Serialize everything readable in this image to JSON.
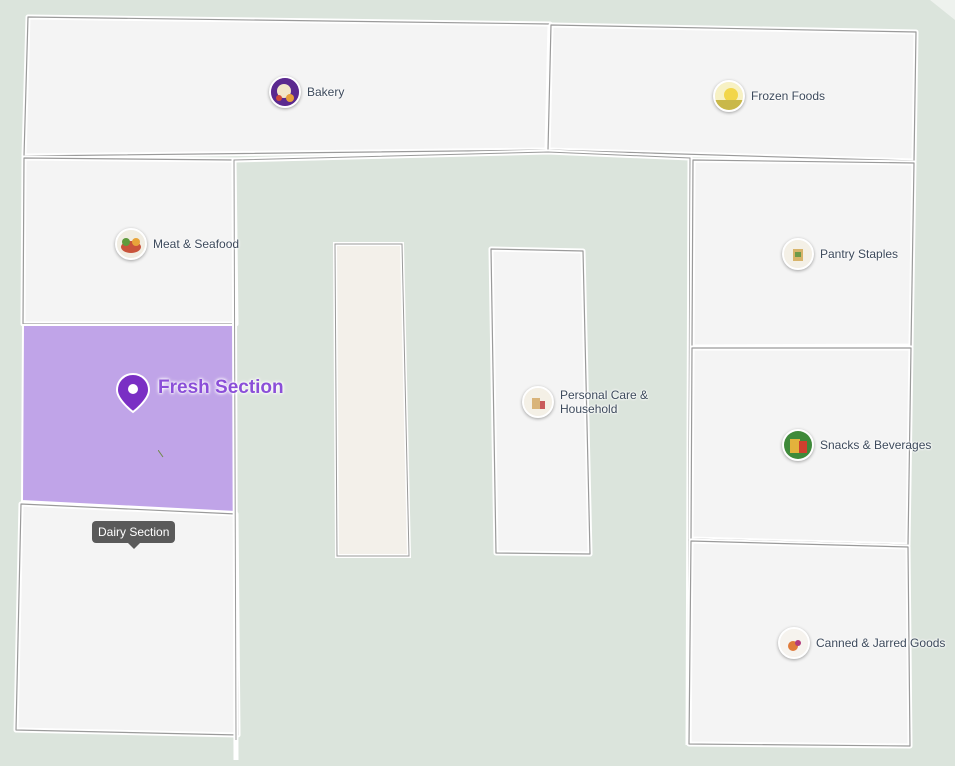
{
  "map": {
    "background": "#dbe4dc",
    "room_fill": "#f4f4f4",
    "wall_color": "#ffffff",
    "highlight_color": "#c0a4e8",
    "highlight_text_color": "#8b4fd8"
  },
  "selected": {
    "title": "Fresh Section",
    "icon": "location-pin-icon"
  },
  "tooltip": {
    "text": "Dairy Section"
  },
  "sections": [
    {
      "id": "bakery",
      "label": "Bakery",
      "icon": "bakery-thumbnail-icon"
    },
    {
      "id": "frozen",
      "label": "Frozen Foods",
      "icon": "frozen-foods-thumbnail-icon"
    },
    {
      "id": "meat",
      "label": "Meat & Seafood",
      "icon": "meat-seafood-thumbnail-icon"
    },
    {
      "id": "pantry",
      "label": "Pantry Staples",
      "icon": "pantry-staples-thumbnail-icon"
    },
    {
      "id": "personal",
      "label": "Personal Care & Household",
      "icon": "personal-care-thumbnail-icon"
    },
    {
      "id": "snacks",
      "label": "Snacks & Beverages",
      "icon": "snacks-beverages-thumbnail-icon"
    },
    {
      "id": "canned",
      "label": "Canned & Jarred Goods",
      "icon": "canned-jarred-thumbnail-icon"
    }
  ]
}
